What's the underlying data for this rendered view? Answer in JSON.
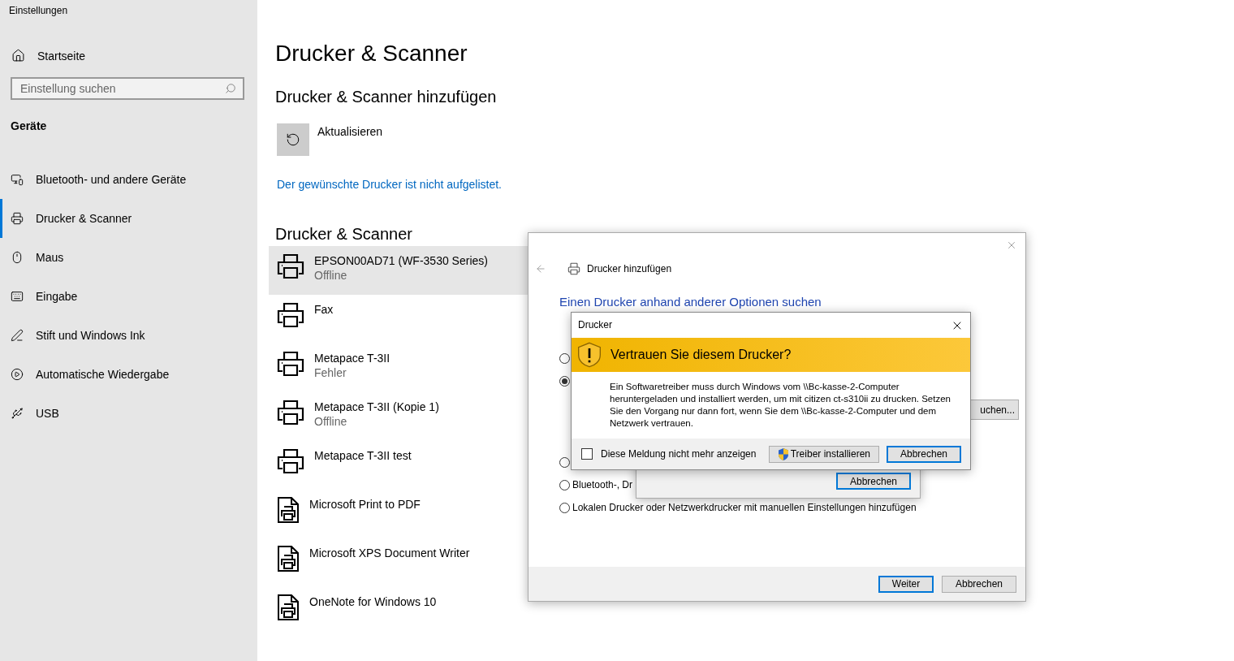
{
  "window": {
    "title": "Einstellungen"
  },
  "sidebar": {
    "home": "Startseite",
    "search": {
      "placeholder": "Einstellung suchen"
    },
    "section": "Geräte",
    "items": [
      {
        "label": "Bluetooth- und andere Geräte",
        "selected": false
      },
      {
        "label": "Drucker & Scanner",
        "selected": true
      },
      {
        "label": "Maus",
        "selected": false
      },
      {
        "label": "Eingabe",
        "selected": false
      },
      {
        "label": "Stift und Windows Ink",
        "selected": false
      },
      {
        "label": "Automatische Wiedergabe",
        "selected": false
      },
      {
        "label": "USB",
        "selected": false
      }
    ]
  },
  "page": {
    "title": "Drucker & Scanner",
    "subtitle": "Drucker & Scanner hinzufügen",
    "refresh": "Aktualisieren",
    "link": "Der gewünschte Drucker ist nicht aufgelistet.",
    "list_title": "Drucker & Scanner",
    "printers": [
      {
        "name": "EPSON00AD71 (WF-3530 Series)",
        "status": "Offline",
        "kind": "printer",
        "selected": true
      },
      {
        "name": "Fax",
        "kind": "printer",
        "selected": false
      },
      {
        "name": "Metapace T-3II",
        "status": "Fehler",
        "kind": "printer",
        "selected": false
      },
      {
        "name": "Metapace T-3II (Kopie 1)",
        "status": "Offline",
        "kind": "printer",
        "selected": false
      },
      {
        "name": "Metapace T-3II test",
        "kind": "printer",
        "selected": false
      },
      {
        "name": "Microsoft Print to PDF",
        "kind": "document",
        "selected": false
      },
      {
        "name": "Microsoft XPS Document Writer",
        "kind": "document",
        "selected": false
      },
      {
        "name": "OneNote for Windows 10",
        "kind": "document",
        "selected": false
      }
    ]
  },
  "add_dialog": {
    "title": "Drucker hinzufügen",
    "heading": "Einen Drucker anhand anderer Optionen suchen",
    "options": [
      {
        "selected": false
      },
      {
        "selected": true
      },
      {
        "selected": false
      },
      {
        "label": "Bluetooth-, Dr",
        "selected": false
      },
      {
        "label": "Lokalen Drucker oder Netzwerkdrucker mit manuellen Einstellungen hinzufügen",
        "selected": false
      }
    ],
    "search_button": "uchen...",
    "buttons": [
      {
        "label": "Weiter",
        "default": true
      },
      {
        "label": "Abbrechen",
        "default": false
      }
    ]
  },
  "hidden_dialog": {
    "buttons": [
      {
        "label": "Abbrechen",
        "default": true
      }
    ]
  },
  "trust_dialog": {
    "title": "Drucker",
    "heading": "Vertrauen Sie diesem Drucker?",
    "message": "Ein Softwaretreiber muss durch Windows vom \\\\Bc-kasse-2-Computer heruntergeladen und installiert werden, um mit citizen ct-s310ii zu drucken. Setzen Sie den Vorgang nur dann fort, wenn Sie dem \\\\Bc-kasse-2-Computer und dem Netzwerk vertrauen.",
    "checkbox": {
      "label": "Diese Meldung nicht mehr anzeigen",
      "checked": false
    },
    "buttons": [
      {
        "label": "Treiber installieren",
        "default": false,
        "shield": true
      },
      {
        "label": "Abbrechen",
        "default": true,
        "shield": false
      }
    ]
  }
}
